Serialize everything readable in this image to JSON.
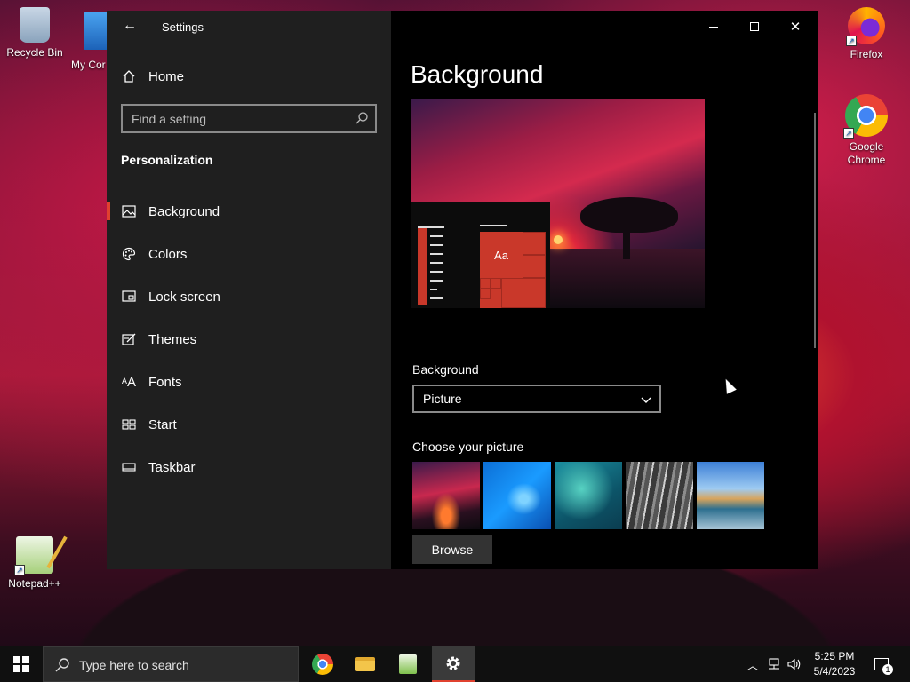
{
  "desktop": {
    "icons": [
      {
        "label": "Recycle Bin"
      },
      {
        "label": "My Cor"
      },
      {
        "label": "Firefox"
      },
      {
        "label": "Google Chrome"
      },
      {
        "label": "Notepad++"
      }
    ]
  },
  "window": {
    "title": "Settings",
    "back_glyph": "←",
    "controls": {
      "minimize": "—",
      "maximize": "☐",
      "close": "✕"
    }
  },
  "sidebar": {
    "home_label": "Home",
    "search_placeholder": "Find a setting",
    "category": "Personalization",
    "items": [
      {
        "label": "Background",
        "icon": "image-icon",
        "active": true
      },
      {
        "label": "Colors",
        "icon": "palette-icon"
      },
      {
        "label": "Lock screen",
        "icon": "lock-screen-icon"
      },
      {
        "label": "Themes",
        "icon": "themes-icon"
      },
      {
        "label": "Fonts",
        "icon": "fonts-icon"
      },
      {
        "label": "Start",
        "icon": "start-icon"
      },
      {
        "label": "Taskbar",
        "icon": "taskbar-icon"
      }
    ]
  },
  "main": {
    "page_title": "Background",
    "preview_tile_text": "Aa",
    "background_label": "Background",
    "background_value": "Picture",
    "choose_label": "Choose your picture",
    "browse_label": "Browse"
  },
  "taskbar": {
    "search_placeholder": "Type here to search",
    "time": "5:25 PM",
    "date": "5/4/2023",
    "notification_count": "1"
  },
  "colors": {
    "accent": "#e0412f",
    "sidebar_bg": "#1f1f1f",
    "main_bg": "#000000"
  }
}
